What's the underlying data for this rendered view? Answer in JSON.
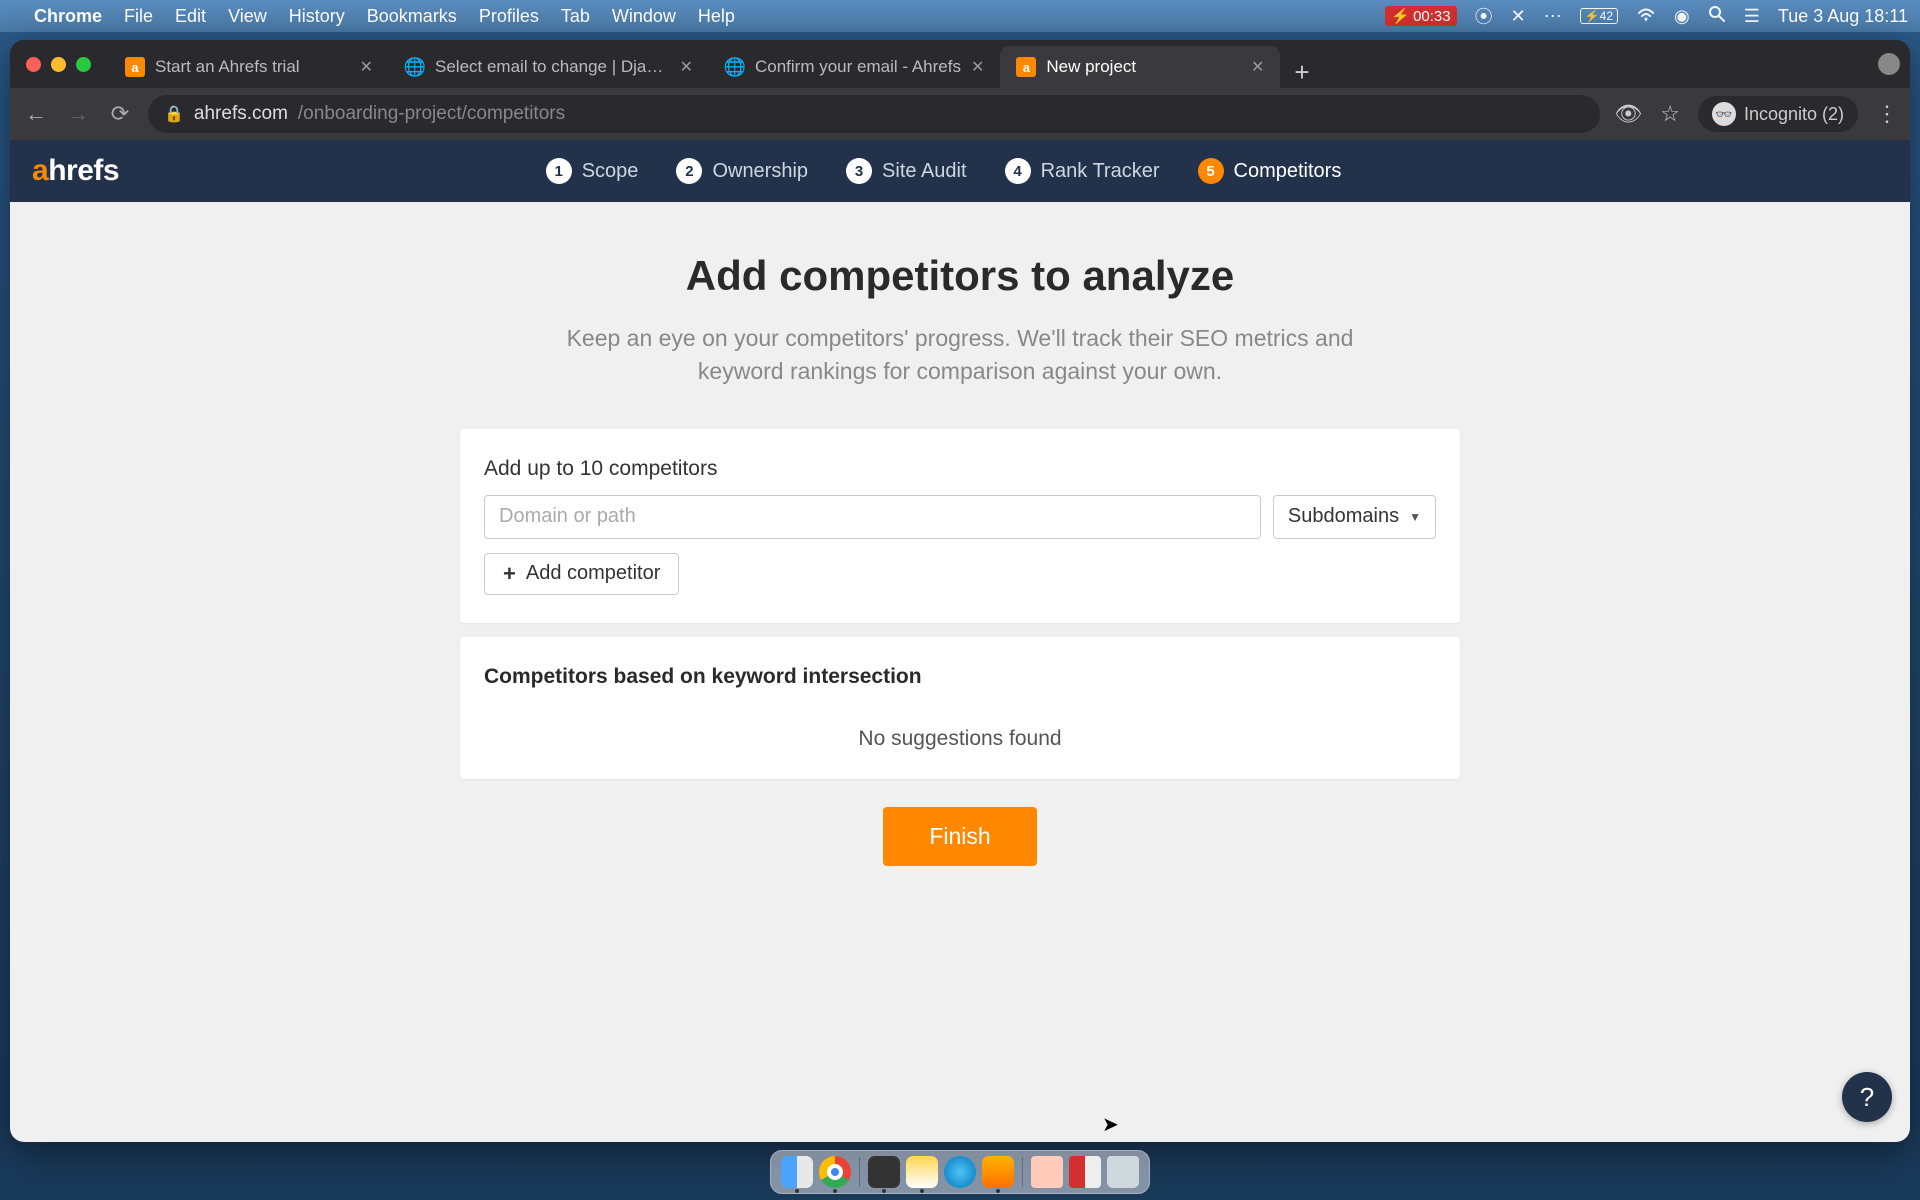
{
  "menubar": {
    "app": "Chrome",
    "items": [
      "File",
      "Edit",
      "View",
      "History",
      "Bookmarks",
      "Profiles",
      "Tab",
      "Window",
      "Help"
    ],
    "timer": "00:33",
    "battery": "42",
    "datetime": "Tue 3 Aug  18:11"
  },
  "tabs": [
    {
      "title": "Start an Ahrefs trial",
      "favicon": "ahrefs"
    },
    {
      "title": "Select email to change | Django",
      "favicon": "globe"
    },
    {
      "title": "Confirm your email - Ahrefs",
      "favicon": "globe"
    },
    {
      "title": "New project",
      "favicon": "ahrefs",
      "active": true
    }
  ],
  "url": {
    "host": "ahrefs.com",
    "path": "/onboarding-project/competitors"
  },
  "incognito": "Incognito (2)",
  "steps": [
    {
      "n": "1",
      "label": "Scope"
    },
    {
      "n": "2",
      "label": "Ownership"
    },
    {
      "n": "3",
      "label": "Site Audit"
    },
    {
      "n": "4",
      "label": "Rank Tracker"
    },
    {
      "n": "5",
      "label": "Competitors",
      "active": true
    }
  ],
  "page": {
    "heading": "Add competitors to analyze",
    "sub": "Keep an eye on your competitors' progress. We'll track their SEO metrics and keyword rankings for comparison against your own.",
    "card_label": "Add up to 10 competitors",
    "placeholder": "Domain or path",
    "scope_select": "Subdomains",
    "add_btn": "Add competitor",
    "intersection_title": "Competitors based on keyword intersection",
    "no_suggestions": "No suggestions found",
    "finish": "Finish"
  },
  "help": "?"
}
